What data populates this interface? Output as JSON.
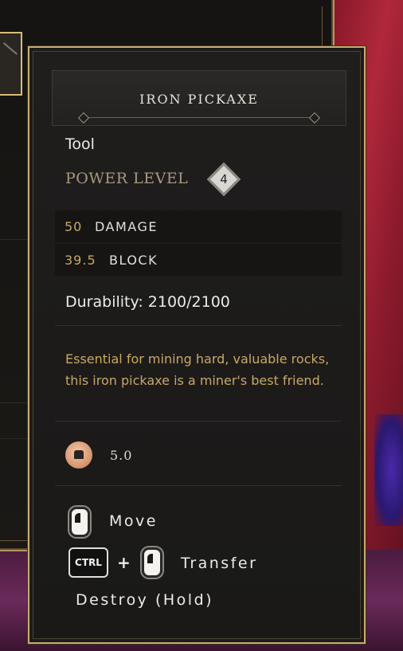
{
  "item": {
    "name": "IRON PICKAXE",
    "type": "Tool",
    "power_level_label": "POWER LEVEL",
    "power_level": "4",
    "stats": [
      {
        "value": "50",
        "label": "DAMAGE"
      },
      {
        "value": "39.5",
        "label": "BLOCK"
      }
    ],
    "durability": "Durability: 2100/2100",
    "description": "Essential for mining hard, valuable rocks, this iron pickaxe is a miner's best friend.",
    "weight": "5.0"
  },
  "controls": {
    "move_label": "Move",
    "ctrl_key": "CTRL",
    "plus": "+",
    "transfer_label": "Transfer",
    "destroy_label": "Destroy (Hold)"
  },
  "colors": {
    "gold_text": "#c9a865",
    "border_gold": "#c8ad72",
    "panel_bg": "#1f1e1d"
  }
}
